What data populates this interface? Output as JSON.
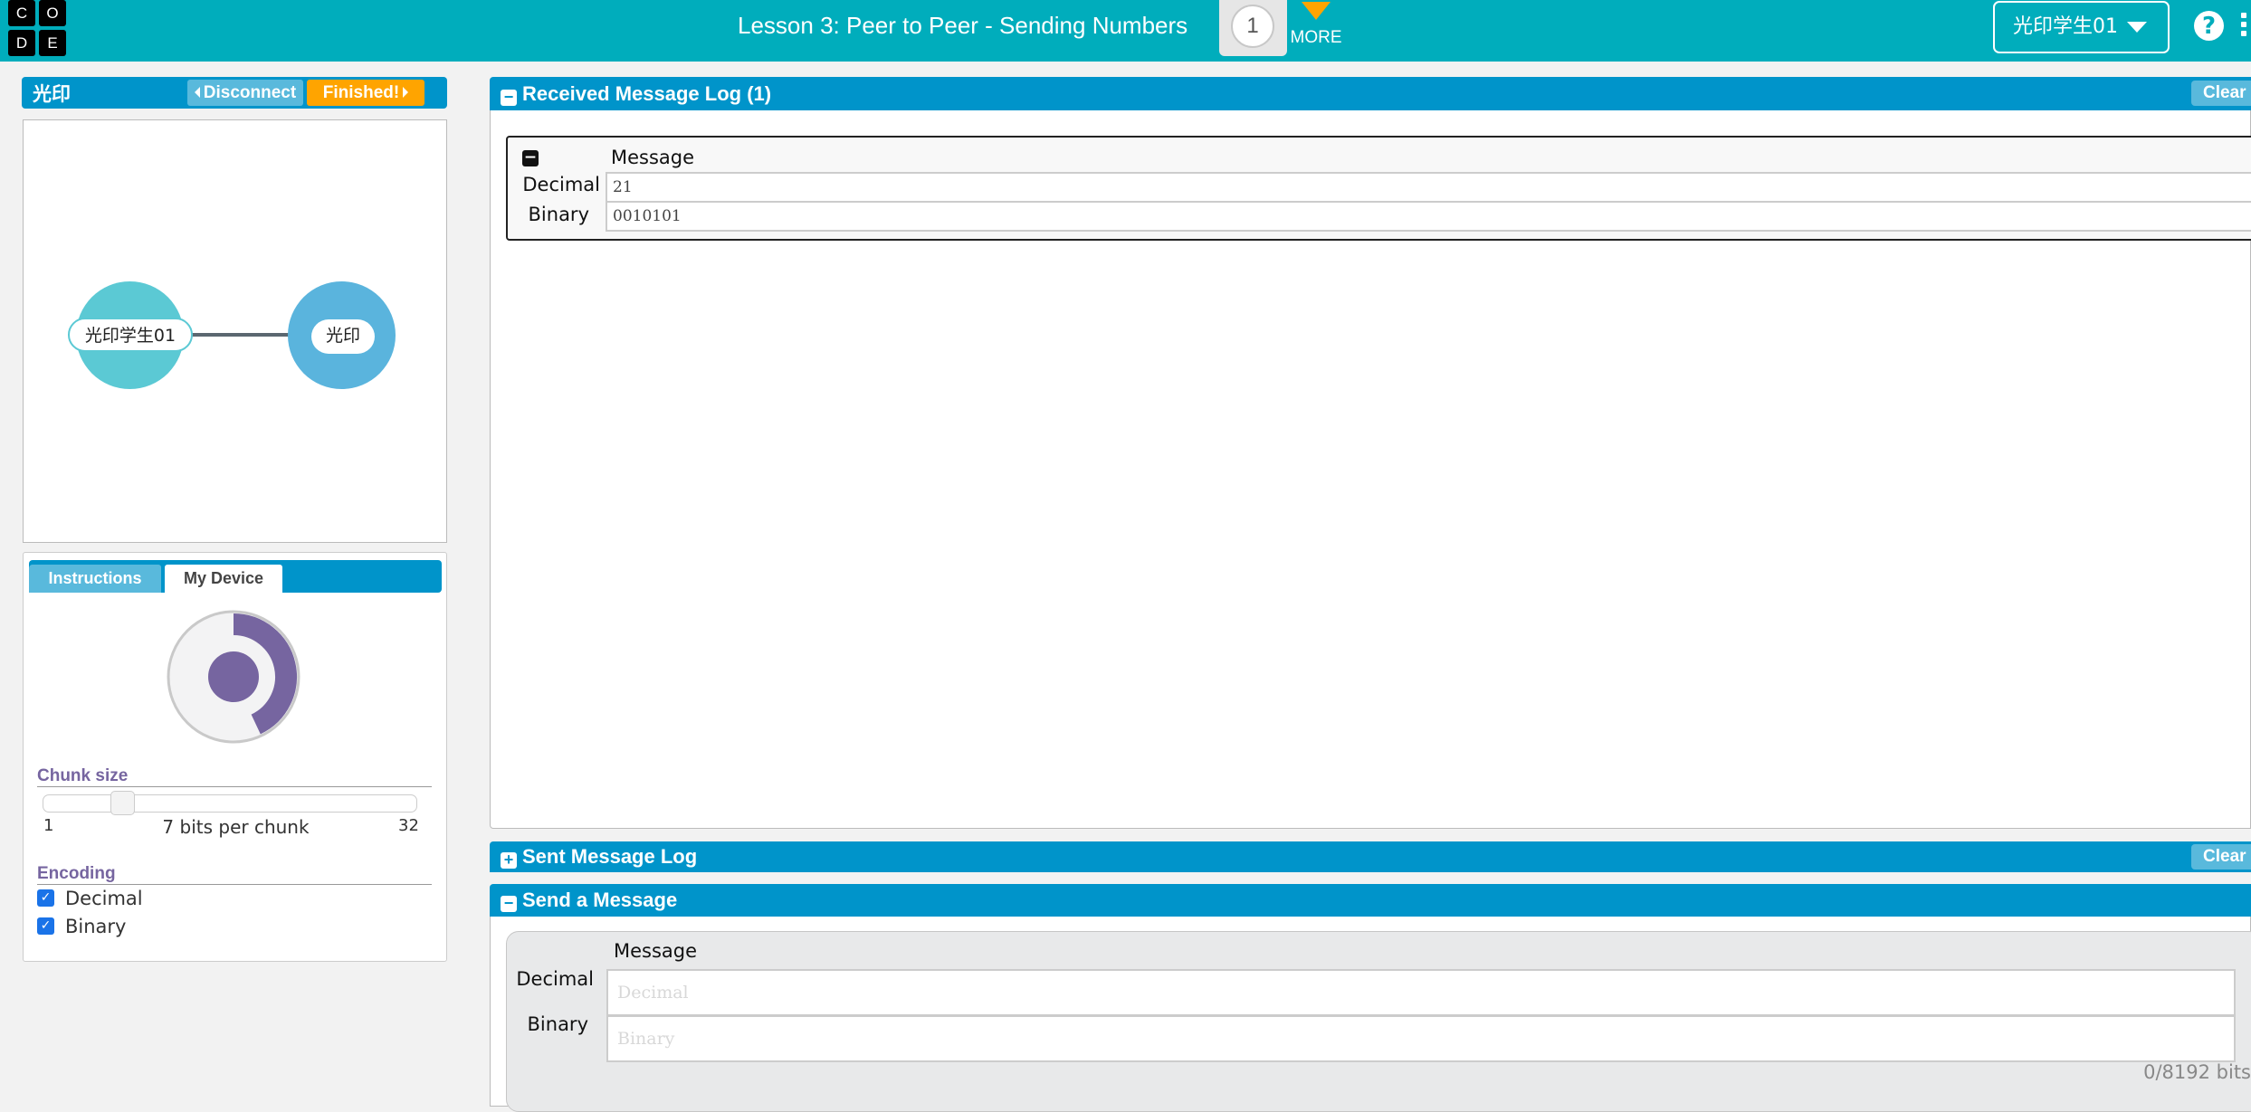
{
  "header": {
    "logo_letters": [
      "C",
      "O",
      "D",
      "E"
    ],
    "lesson_title": "Lesson 3: Peer to Peer - Sending Numbers",
    "level_number": "1",
    "more_label": "MORE",
    "user_name": "光印学生01",
    "help_icon": "question-circle-icon",
    "menu_icon": "kebab-icon",
    "colors": {
      "bar": "#00adbc",
      "more_arrow": "#ffa400"
    }
  },
  "peer_bar": {
    "peer_name": "光印",
    "disconnect_label": "Disconnect",
    "finished_label": "Finished!",
    "colors": {
      "bar": "#0094ca",
      "disconnect": "#59b9dc",
      "finished": "#ffa400"
    }
  },
  "network": {
    "nodes": [
      {
        "label": "光印学生01",
        "color": "#5bc9d4",
        "is_self": true
      },
      {
        "label": "光印",
        "color": "#5ab4dd",
        "is_self": false
      }
    ],
    "connected": true
  },
  "device_tabs": {
    "tabs": [
      {
        "label": "Instructions",
        "active": false
      },
      {
        "label": "My Device",
        "active": true
      }
    ]
  },
  "device": {
    "dial_progress_fraction": 0.43,
    "dial_color": "#7665a0",
    "chunk_size": {
      "title": "Chunk size",
      "min": "1",
      "max": "32",
      "value": 7,
      "value_label": "7 bits per chunk"
    },
    "encoding": {
      "title": "Encoding",
      "options": [
        {
          "label": "Decimal",
          "checked": true
        },
        {
          "label": "Binary",
          "checked": true
        }
      ]
    }
  },
  "received_log": {
    "title": "Received Message Log (1)",
    "clear_label": "Clear",
    "messages": [
      {
        "column_header": "Message",
        "rows": [
          {
            "label": "Decimal",
            "value": "21"
          },
          {
            "label": "Binary",
            "value": "0010101"
          }
        ]
      }
    ]
  },
  "sent_log": {
    "title": "Sent Message Log",
    "clear_label": "Clear",
    "expanded": false
  },
  "send_message": {
    "title": "Send a Message",
    "column_header": "Message",
    "fields": [
      {
        "label": "Decimal",
        "value": "",
        "placeholder": "Decimal"
      },
      {
        "label": "Binary",
        "value": "",
        "placeholder": "Binary"
      }
    ],
    "bits_counter": "0/8192 bits"
  }
}
